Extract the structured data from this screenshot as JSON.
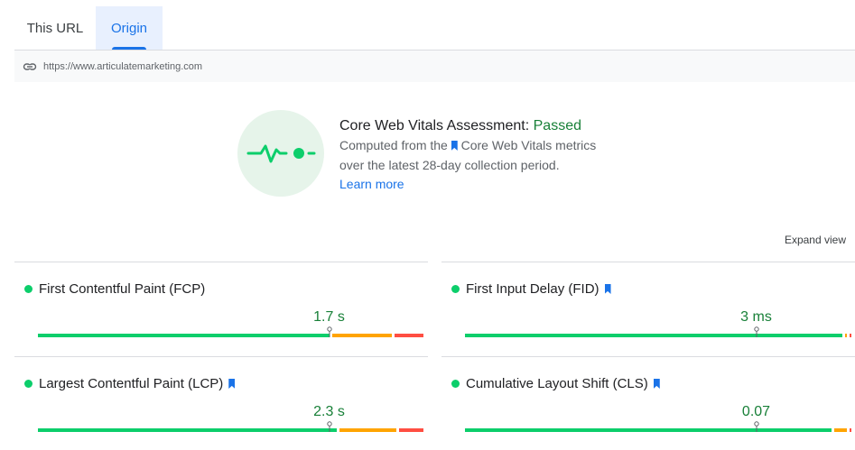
{
  "tabs": [
    {
      "label": "This URL",
      "active": false
    },
    {
      "label": "Origin",
      "active": true
    }
  ],
  "url": {
    "icon": "link-icon",
    "text": "https://www.articulatemarketing.com"
  },
  "assessment": {
    "icon": "vitals-pulse-icon",
    "title": "Core Web Vitals Assessment:",
    "status": "Passed",
    "desc_prefix": "Computed from the",
    "desc_link": "Core Web Vitals metrics",
    "desc_suffix": "over the latest 28-day collection period.",
    "learn_more": "Learn more"
  },
  "expand_view": "Expand view",
  "colors": {
    "good": "#0cce6b",
    "needs_improvement": "#ffa400",
    "poor": "#ff4e42",
    "link": "#1a73e8",
    "value_text": "#188038"
  },
  "metrics": [
    {
      "key": "fcp",
      "label": "First Contentful Paint (FCP)",
      "value": "1.7 s",
      "core_vital": false,
      "status": "good",
      "distribution": [
        0.75,
        0.16,
        0.08
      ],
      "marker": 0.75
    },
    {
      "key": "fid",
      "label": "First Input Delay (FID)",
      "value": "3 ms",
      "core_vital": true,
      "status": "good",
      "distribution": [
        0.98,
        0.01,
        0.01
      ],
      "marker": 0.75
    },
    {
      "key": "lcp",
      "label": "Largest Contentful Paint (LCP)",
      "value": "2.3 s",
      "core_vital": true,
      "status": "good",
      "distribution": [
        0.77,
        0.15,
        0.07
      ],
      "marker": 0.75
    },
    {
      "key": "cls",
      "label": "Cumulative Layout Shift (CLS)",
      "value": "0.07",
      "core_vital": true,
      "status": "good",
      "distribution": [
        0.95,
        0.04,
        0.01
      ],
      "marker": 0.75
    }
  ]
}
